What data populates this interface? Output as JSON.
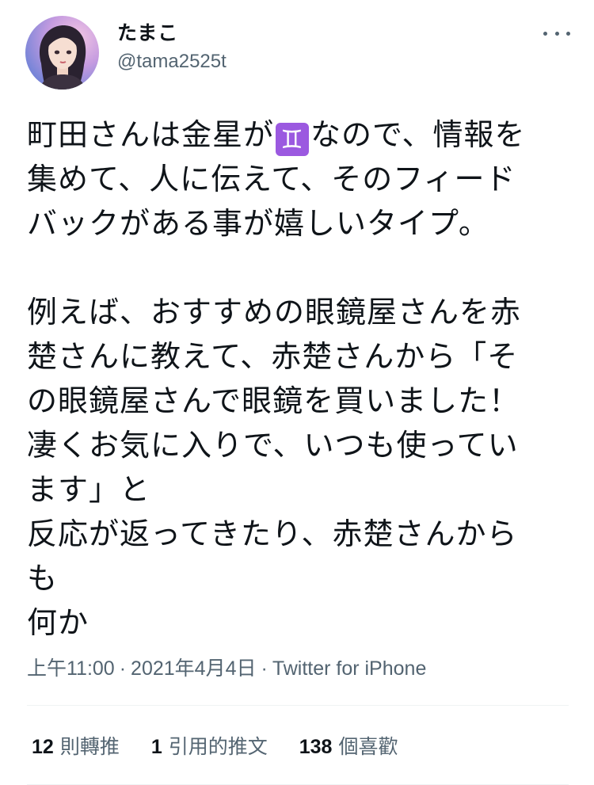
{
  "author": {
    "display_name": "たまこ",
    "handle": "@tama2525t",
    "avatar_icon": "avatar-anime-girl"
  },
  "tweet": {
    "text_before_emoji": "町田さんは金星が",
    "emoji": "♊",
    "emoji_color": "#9b59e0",
    "text_after_emoji": "なので、情報を\n集めて、人に伝えて、そのフィード\nバックがある事が嬉しいタイプ。\n\n例えば、おすすめの眼鏡屋さんを赤\n楚さんに教えて、赤楚さんから「そ\nの眼鏡屋さんで眼鏡を買いました！\n凄くお気に入りで、いつも使ってい\nます」と\n反応が返ってきたり、赤楚さんから\nも\n何か"
  },
  "meta": {
    "time": "上午11:00",
    "separator": "·",
    "date": "2021年4月4日",
    "source": "Twitter for iPhone"
  },
  "stats": {
    "retweets_count": "12",
    "retweets_label": "則轉推",
    "quotes_count": "1",
    "quotes_label": "引用的推文",
    "likes_count": "138",
    "likes_label": "個喜歡"
  }
}
